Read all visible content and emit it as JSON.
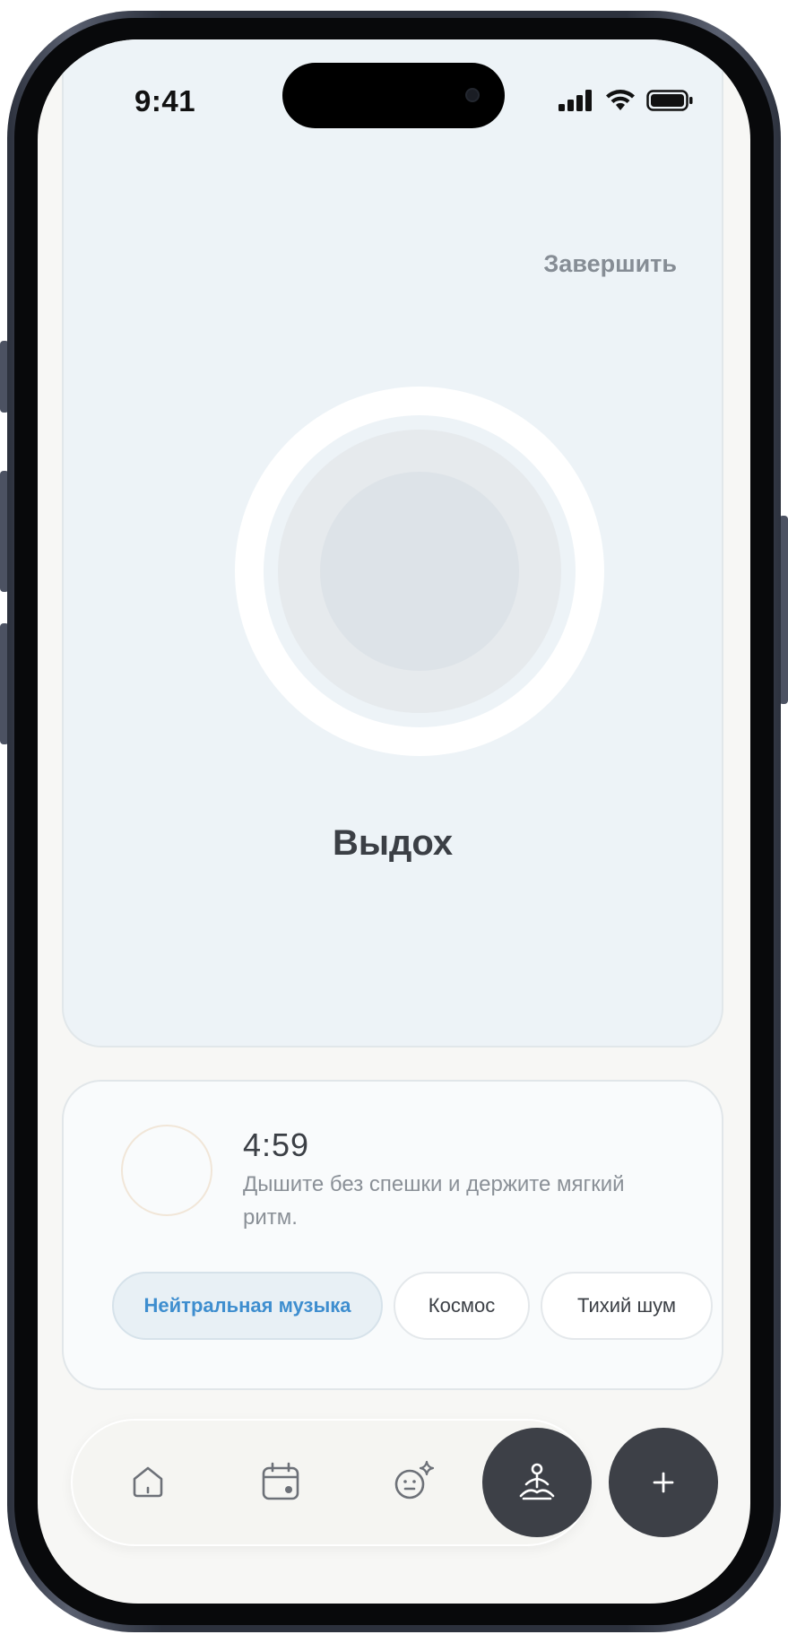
{
  "status_bar": {
    "time": "9:41"
  },
  "session": {
    "finish_label": "Завершить",
    "phase": "Выдох"
  },
  "info": {
    "timer": "4:59",
    "hint": "Дышите без спешки и держите мягкий ритм."
  },
  "sound_options": [
    {
      "label": "Нейтральная музыка",
      "selected": true
    },
    {
      "label": "Космос",
      "selected": false
    },
    {
      "label": "Тихий шум",
      "selected": false
    }
  ],
  "tabbar": {
    "items": [
      {
        "icon": "home-icon"
      },
      {
        "icon": "calendar-icon"
      },
      {
        "icon": "mood-face-icon"
      },
      {
        "icon": "meditation-icon",
        "active": true
      }
    ],
    "add_icon": "plus-icon"
  },
  "colors": {
    "accent": "#3e8ecf",
    "dark": "#3d4047",
    "card_bg": "#edf3f7"
  }
}
